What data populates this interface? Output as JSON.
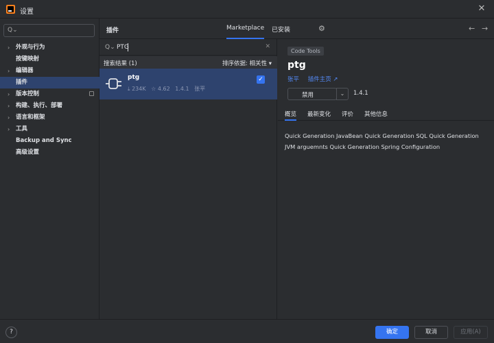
{
  "window": {
    "title": "设置",
    "close_glyph": "✕"
  },
  "left": {
    "search_icon_glyph": "Q⌄",
    "items": [
      {
        "label": "外观与行为",
        "expandable": true
      },
      {
        "label": "按键映射",
        "expandable": false
      },
      {
        "label": "编辑器",
        "expandable": true
      },
      {
        "label": "插件",
        "expandable": false,
        "selected": true
      },
      {
        "label": "版本控制",
        "expandable": true
      },
      {
        "label": "构建、执行、部署",
        "expandable": true
      },
      {
        "label": "语言和框架",
        "expandable": true
      },
      {
        "label": "工具",
        "expandable": true
      },
      {
        "label": "Backup and Sync",
        "expandable": false
      },
      {
        "label": "高级设置",
        "expandable": false
      }
    ]
  },
  "header": {
    "title": "插件",
    "tabs": [
      {
        "label": "Marketplace",
        "active": true
      },
      {
        "label": "已安装",
        "active": false
      }
    ],
    "gear_glyph": "⚙",
    "back_glyph": "←",
    "forward_glyph": "→"
  },
  "plugins": {
    "search_icon_glyph": "Q⌄",
    "search_value": "PTG",
    "clear_glyph": "✕",
    "results_label": "搜索结果 (1)",
    "sort_label": "排序依据: 相关性 ▾",
    "list": [
      {
        "name": "ptg",
        "downloads": "⤓ 234K",
        "rating": "☆ 4.62",
        "version": "1.4.1",
        "vendor": "张平",
        "checked": true
      }
    ]
  },
  "detail": {
    "tag": "Code Tools",
    "name": "ptg",
    "vendor": "张平",
    "homepage_label": "插件主页 ↗",
    "disable_label": "禁用",
    "dropdown_glyph": "⌄",
    "version": "1.4.1",
    "tabs": [
      {
        "label": "概览",
        "active": true
      },
      {
        "label": "最新变化"
      },
      {
        "label": "评价"
      },
      {
        "label": "其他信息"
      }
    ],
    "description": "Quick Generation JavaBean Quick Generation SQL Quick Generation JVM arguemnts Quick Generation Spring Configuration"
  },
  "footer": {
    "help_label": "?",
    "ok_label": "确定",
    "cancel_label": "取消",
    "apply_label": "应用(A)"
  },
  "colors": {
    "accent": "#3574f0",
    "selection": "#2e436e",
    "link": "#548af7",
    "background": "#2b2d30"
  }
}
